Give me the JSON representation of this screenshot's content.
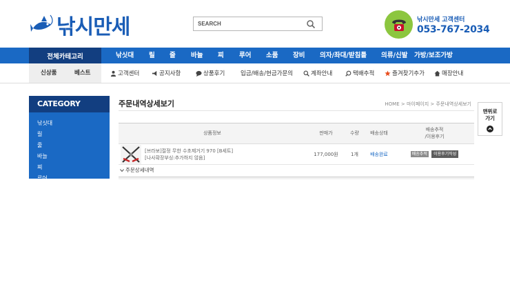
{
  "header": {
    "logo_text": "낚시만세",
    "search_placeholder": "SEARCH",
    "cs_label": "낚시만세 고객센터",
    "cs_phone": "053-767-2034"
  },
  "nav": {
    "all_categories": "전체카테고리",
    "items": [
      "낚싯대",
      "릴",
      "줄",
      "바늘",
      "찌",
      "루어",
      "소품",
      "장비",
      "의자/좌대/받침틀",
      "의류/신발",
      "가방/보조가방"
    ]
  },
  "subnav": {
    "tabs": [
      "신상품",
      "베스트"
    ],
    "items": [
      "고객센터",
      "공지사항",
      "상품후기",
      "입금/배송/현금가문의",
      "계좌안내",
      "택배추적",
      "즐겨찾기추가",
      "매장안내"
    ]
  },
  "sidebar": {
    "title": "CATEGORY",
    "items": [
      "낚싯대",
      "릴",
      "줄",
      "바늘",
      "찌",
      "루어"
    ]
  },
  "content": {
    "page_title": "주문내역상세보기",
    "breadcrumb": "HOME > 마이페이지 > 주문내역상세보기",
    "table": {
      "headers": {
        "product": "상품정보",
        "price": "판매가",
        "qty": "수량",
        "status": "배송상태",
        "tracking": "배송추적",
        "review": "/이용후기"
      },
      "rows": [
        {
          "name_line1": "[브라보]절정 무한 수초제거기 970 [B세트]",
          "name_line2": "[나사확장부싱:추가하지 않음]",
          "price": "177,000원",
          "qty": "1개",
          "status": "배송완료",
          "track_btn": "배송추적",
          "review_btn": "이용후기작성"
        }
      ]
    },
    "detail_label": "주문상세내역"
  },
  "totop": {
    "line1": "맨위로",
    "line2": "가기"
  },
  "colors": {
    "brand_blue": "#1a69c4",
    "dark_blue": "#123e80",
    "cs_green": "#8cc63f"
  }
}
